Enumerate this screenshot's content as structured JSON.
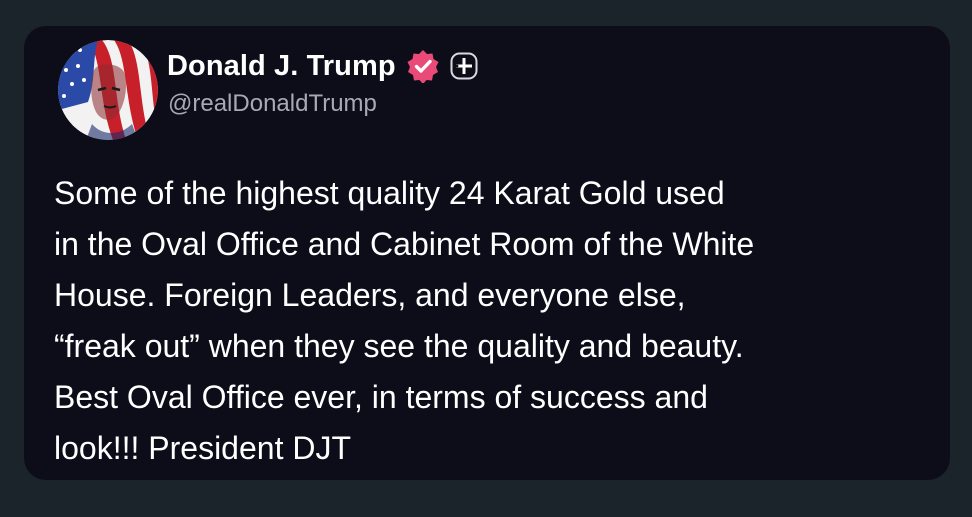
{
  "post": {
    "author": {
      "display_name": "Donald J. Trump",
      "handle": "@realDonaldTrump",
      "avatar_icon": "flag-portrait-avatar",
      "verified_icon": "verified-badge-icon",
      "verified_color": "#e94a77",
      "extra_badge_icon": "plus-badge-icon"
    },
    "text": "Some of the highest quality 24 Karat Gold used\nin the Oval Office and Cabinet Room of the White\nHouse. Foreign Leaders, and everyone else,\n“freak out” when they see the quality and beauty.\nBest Oval Office ever, in terms of success and\nlook!!! President DJT"
  },
  "colors": {
    "page_background": "#1b232b",
    "card_background": "#0d0d1a",
    "text_primary": "#ffffff",
    "text_secondary": "#a7a9b4"
  }
}
